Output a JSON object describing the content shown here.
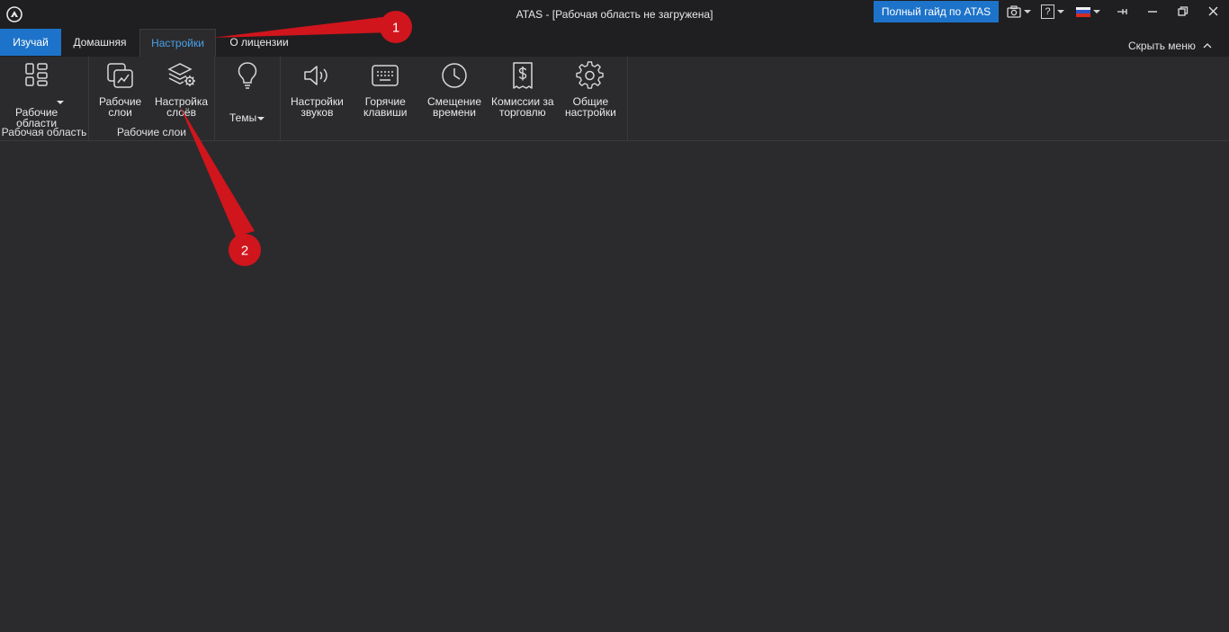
{
  "window": {
    "title": "ATAS - [Рабочая область не загружена]",
    "guide_button": "Полный гайд по ATAS",
    "help_label": "?"
  },
  "tabs": [
    {
      "label": "Изучай"
    },
    {
      "label": "Домашняя"
    },
    {
      "label": "Настройки",
      "selected": true
    },
    {
      "label": "О лицензии"
    }
  ],
  "hide_menu": "Скрыть меню",
  "ribbon": {
    "workspaces_btn": "Рабочие\nобласти",
    "workspace_group": "Рабочая область",
    "layers_btn": "Рабочие\nслои",
    "layer_settings_btn": "Настройка\nслоёв",
    "layers_group": "Рабочие слои",
    "themes_btn": "Темы",
    "sounds_btn": "Настройки\nзвуков",
    "hotkeys_btn": "Горячие\nклавиши",
    "time_offset_btn": "Смещение\nвремени",
    "commissions_btn": "Комиссии за\nторговлю",
    "general_btn": "Общие\nнастройки"
  },
  "annotations": {
    "badge1": "1",
    "badge2": "2",
    "color": "#d0151c"
  },
  "colors": {
    "accent": "#1d73c9",
    "background": "#2b2b2e",
    "titlebar": "#1f1f21"
  }
}
